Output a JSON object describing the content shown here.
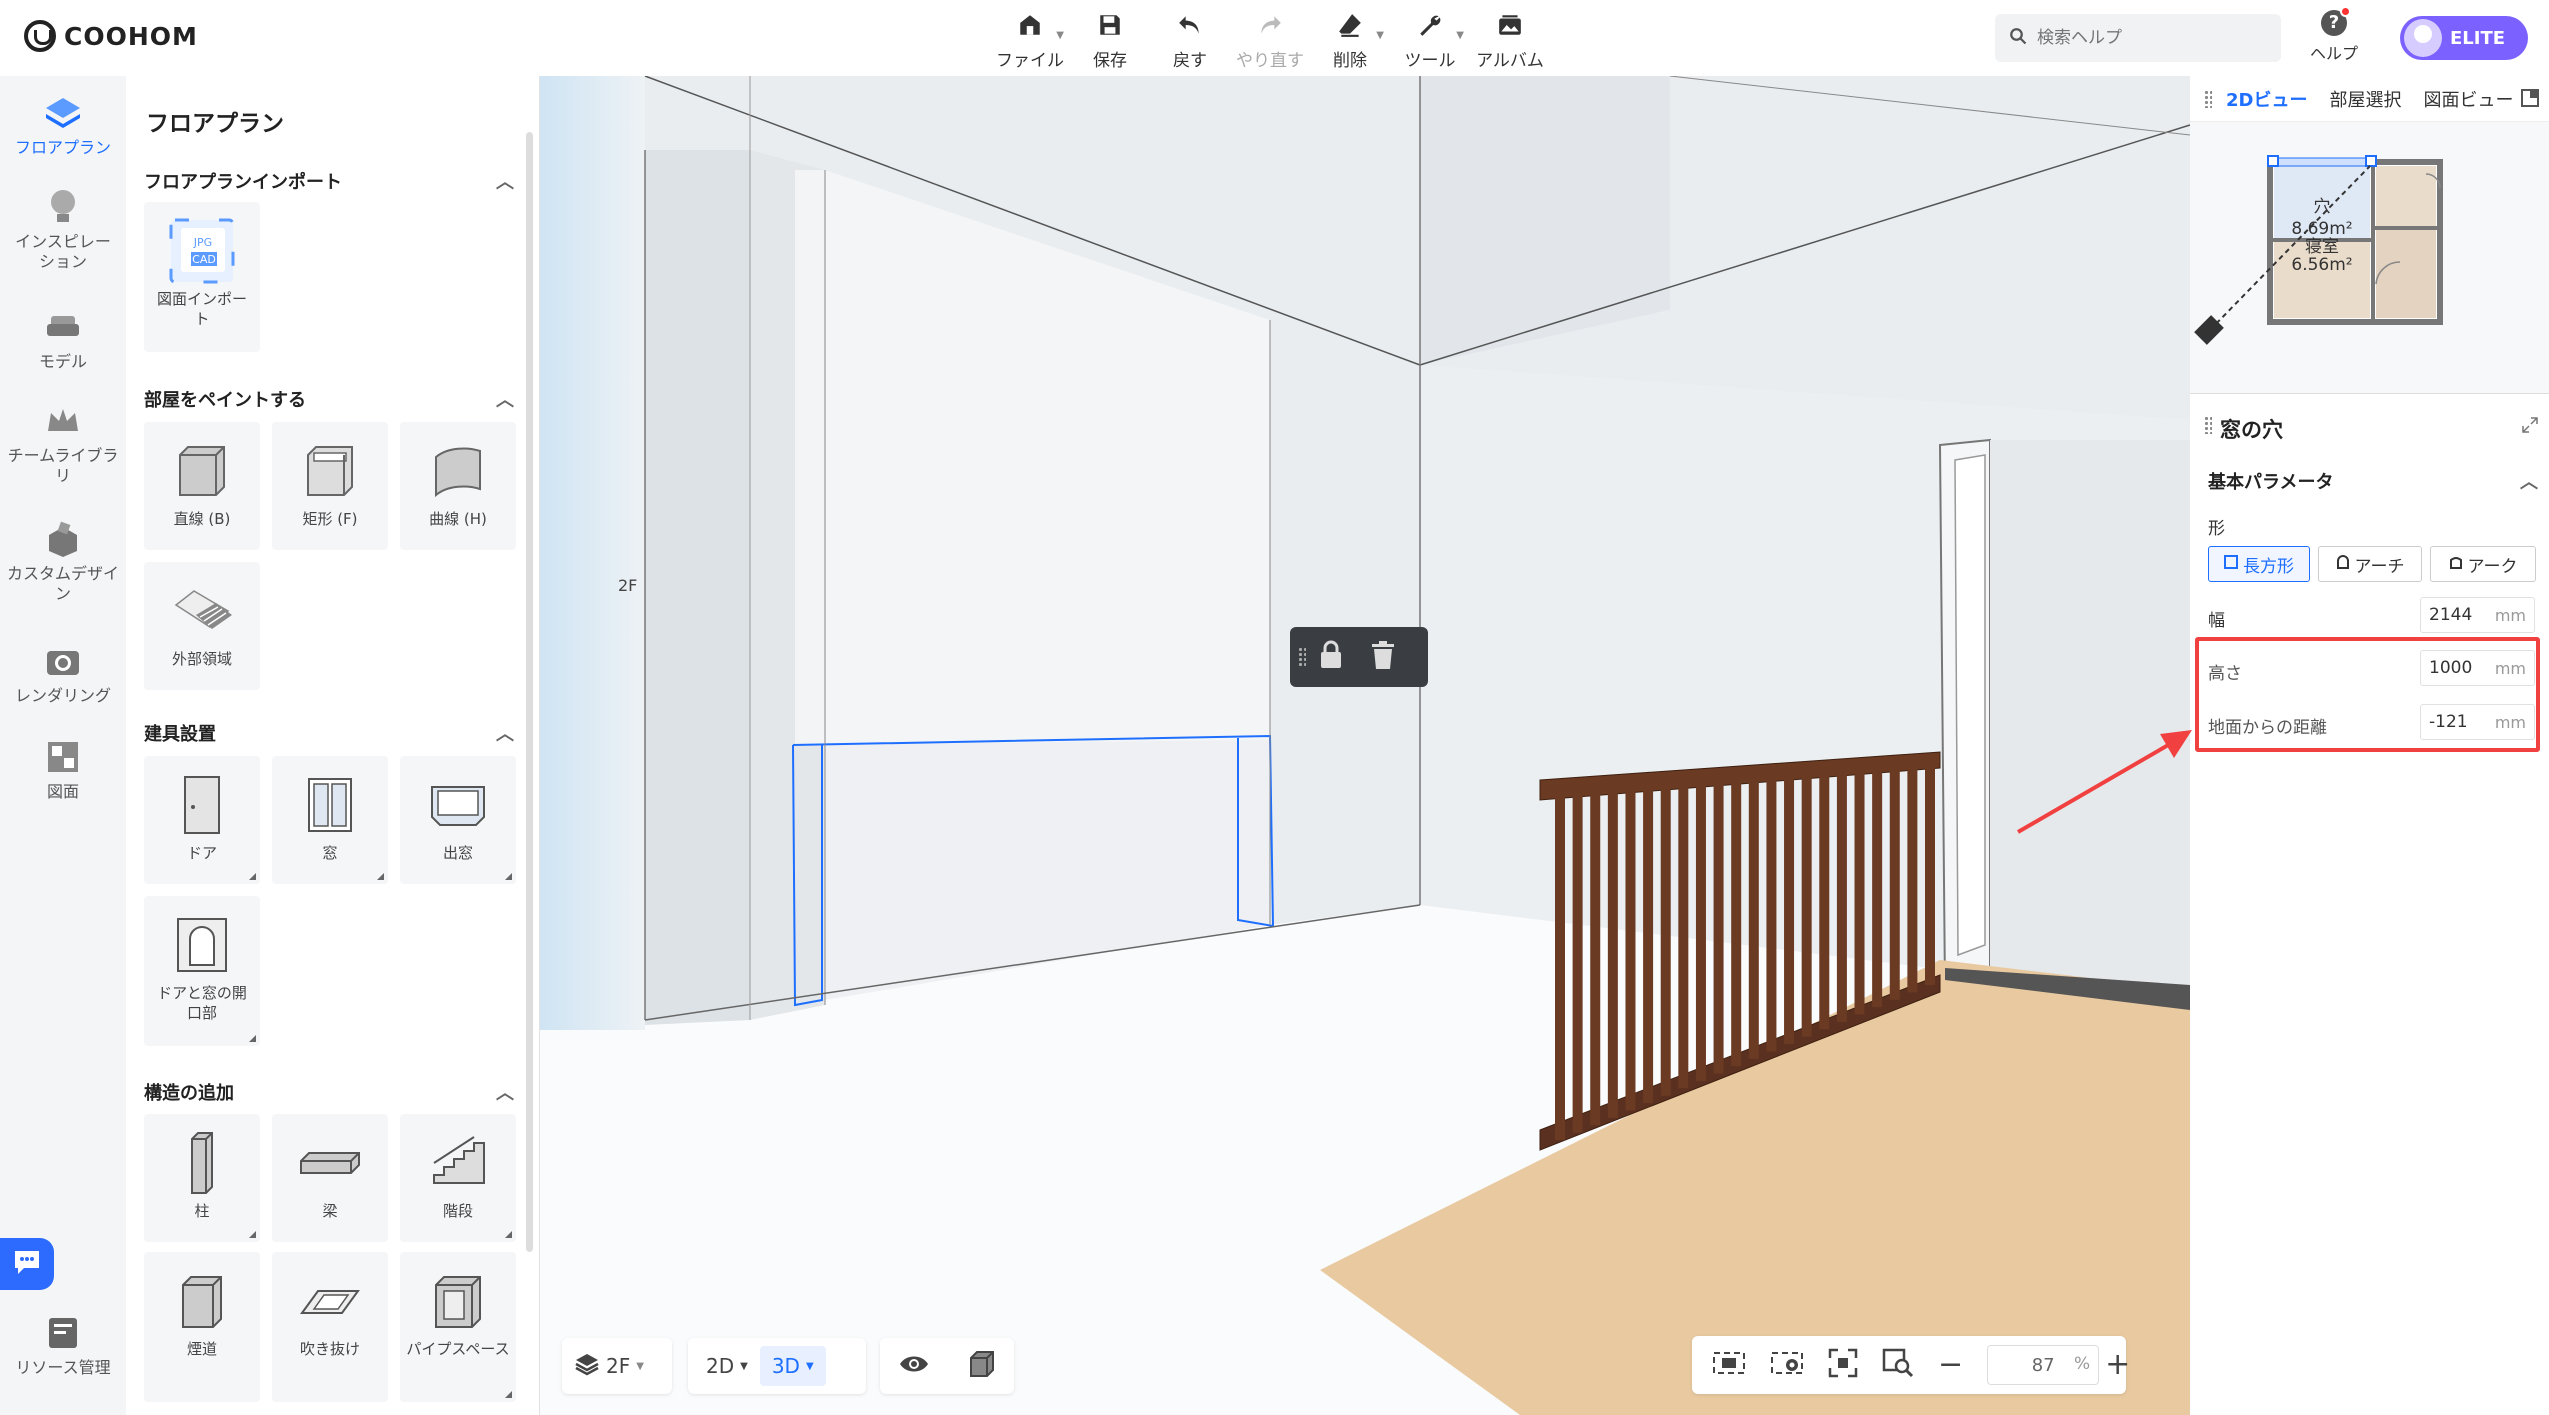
{
  "app": {
    "logo_text": "COOHOM"
  },
  "toolbar": {
    "items": [
      {
        "label": "ファイル",
        "icon": "home-icon",
        "has_menu": true
      },
      {
        "label": "保存",
        "icon": "save-icon",
        "has_menu": false
      },
      {
        "label": "戻す",
        "icon": "undo-icon",
        "has_menu": false
      },
      {
        "label": "やり直す",
        "icon": "redo-icon",
        "has_menu": false,
        "disabled": true
      },
      {
        "label": "削除",
        "icon": "eraser-icon",
        "has_menu": true
      },
      {
        "label": "ツール",
        "icon": "wrench-icon",
        "has_menu": true
      },
      {
        "label": "アルバム",
        "icon": "album-icon",
        "has_menu": false
      }
    ]
  },
  "search": {
    "placeholder": "検索ヘルプ"
  },
  "help": {
    "label": "ヘルプ"
  },
  "account": {
    "badge": "ELITE"
  },
  "leftnav": {
    "items": [
      {
        "label": "フロアプラン",
        "icon": "floorplan-icon",
        "active": true
      },
      {
        "label": "インスピレーション",
        "icon": "lightbulb-icon"
      },
      {
        "label": "モデル",
        "icon": "sofa-icon"
      },
      {
        "label": "チームライブラリ",
        "icon": "crown-icon"
      },
      {
        "label": "カスタムデザイン",
        "icon": "custom-design-icon"
      },
      {
        "label": "レンダリング",
        "icon": "camera-icon"
      },
      {
        "label": "図面",
        "icon": "drawing-icon"
      },
      {
        "label": "リソース管理",
        "icon": "resource-icon"
      }
    ]
  },
  "panel": {
    "title": "フロアプラン",
    "sections": [
      {
        "title": "フロアプランインポート",
        "items": [
          {
            "label": "図面インポート"
          }
        ]
      },
      {
        "title": "部屋をペイントする",
        "items": [
          {
            "label": "直線 (B)"
          },
          {
            "label": "矩形 (F)"
          },
          {
            "label": "曲線 (H)"
          },
          {
            "label": "外部領域"
          }
        ]
      },
      {
        "title": "建具設置",
        "items": [
          {
            "label": "ドア"
          },
          {
            "label": "窓"
          },
          {
            "label": "出窓"
          },
          {
            "label": "ドアと窓の開口部"
          }
        ]
      },
      {
        "title": "構造の追加",
        "items": [
          {
            "label": "柱"
          },
          {
            "label": "梁"
          },
          {
            "label": "階段"
          },
          {
            "label": "煙道"
          },
          {
            "label": "吹き抜け"
          },
          {
            "label": "パイプスペース"
          }
        ]
      }
    ]
  },
  "viewport": {
    "floor_label": "2F"
  },
  "bottombar": {
    "floor": "2F",
    "view2d": "2D",
    "view3d": "3D"
  },
  "zoom": {
    "value": "87",
    "unit": "%"
  },
  "minimap": {
    "tabs": [
      "2Dビュー",
      "部屋選択",
      "図面ビュー"
    ],
    "room_label_1": "穴",
    "room_area_1": "8.69m²",
    "room_label_2": "寝室",
    "room_area_2": "6.56m²"
  },
  "properties": {
    "title": "窓の穴",
    "section": "基本パラメータ",
    "shape_label": "形",
    "shapes": [
      "長方形",
      "アーチ",
      "アーク"
    ],
    "width_label": "幅",
    "width_value": "2144",
    "height_label": "高さ",
    "height_value": "1000",
    "ground_label": "地面からの距離",
    "ground_value": "-121",
    "unit": "mm"
  },
  "colors": {
    "accent": "#1e6fff",
    "highlight": "#f04040",
    "wood": "#e8c9a0",
    "railing": "#5a3020"
  }
}
